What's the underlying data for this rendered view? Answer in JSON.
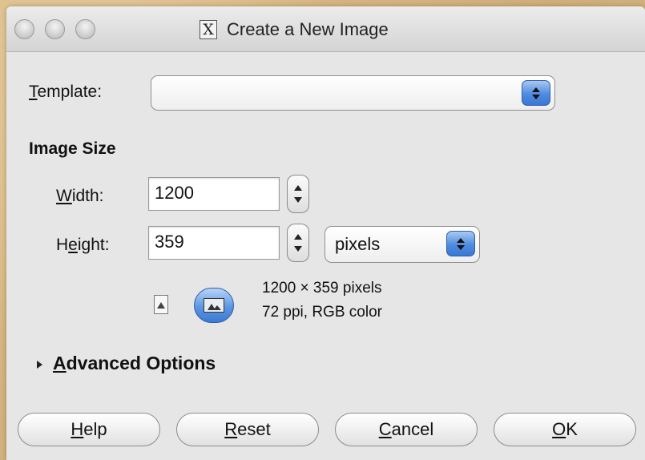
{
  "window": {
    "title": "Create a New Image",
    "title_icon": "x11-icon"
  },
  "template": {
    "label_mnemonic": "T",
    "label_rest": "emplate:",
    "value": ""
  },
  "image_size": {
    "heading": "Image Size",
    "width": {
      "label_mnemonic": "W",
      "label_rest": "idth:",
      "value": "1200"
    },
    "height": {
      "label_pre": "H",
      "label_mnemonic": "e",
      "label_rest": "ight:",
      "value": "359"
    },
    "unit": "pixels",
    "info_line1": "1200 × 359 pixels",
    "info_line2": "72 ppi, RGB color",
    "orientation": "landscape"
  },
  "advanced": {
    "label_mnemonic": "A",
    "label_rest": "dvanced Options",
    "expanded": false
  },
  "buttons": {
    "help": {
      "mnemonic": "H",
      "rest": "elp"
    },
    "reset": {
      "mnemonic": "R",
      "rest": "eset"
    },
    "cancel": {
      "mnemonic": "C",
      "rest": "ancel"
    },
    "ok": {
      "mnemonic": "O",
      "rest": "K"
    }
  },
  "colors": {
    "accent": "#4f8be0",
    "window_bg": "#e6e6e6",
    "desktop": "#d8bc8a"
  }
}
